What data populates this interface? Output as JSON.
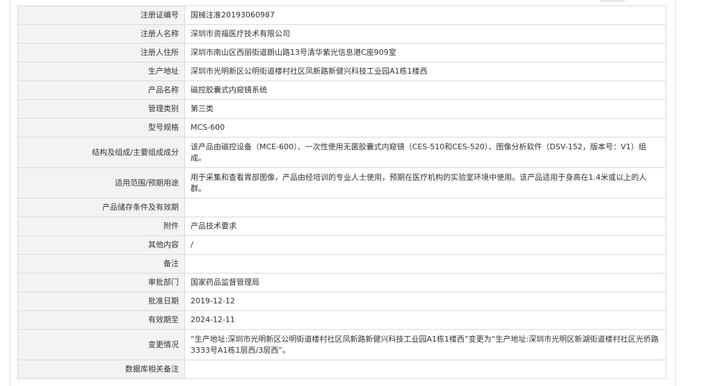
{
  "rows": [
    {
      "label": "注册证编号",
      "value": "国械注准20193060987"
    },
    {
      "label": "注册人名称",
      "value": "深圳市资福医疗技术有限公司"
    },
    {
      "label": "注册人住所",
      "value": "深圳市南山区西丽街道朗山路13号清华紫光信息港C座909室"
    },
    {
      "label": "生产地址",
      "value": "深圳市光明新区公明街道楼村社区凤新路新健兴科技工业园A1栋1楼西"
    },
    {
      "label": "产品名称",
      "value": "磁控胶囊式内窥镜系统"
    },
    {
      "label": "管理类别",
      "value": "第三类"
    },
    {
      "label": "型号规格",
      "value": "MCS-600"
    },
    {
      "label": "结构及组成/主要组成成分",
      "value": "该产品由磁控设备（MCE-600）、一次性使用无菌胶囊式内窥镜（CES-510和CES-520）、图像分析软件（DSV-152，版本号：V1）组成。"
    },
    {
      "label": "适用范围/预期用途",
      "value": "用于采集和查看胃部图像，产品由经培训的专业人士使用，预期在医疗机构的实验室环境中使用。该产品适用于身高在1.4米或以上的人群。"
    },
    {
      "label": "产品储存条件及有效期",
      "value": ""
    },
    {
      "label": "附件",
      "value": "产品技术要求"
    },
    {
      "label": "其他内容",
      "value": "/"
    },
    {
      "label": "备注",
      "value": ""
    },
    {
      "label": "审批部门",
      "value": "国家药品监督管理局"
    },
    {
      "label": "批准日期",
      "value": "2019-12-12"
    },
    {
      "label": "有效期至",
      "value": "2024-12-11"
    },
    {
      "label": "变更情况",
      "value": "“生产地址:深圳市光明新区公明街道楼村社区凤新路新健兴科技工业园A1栋1楼西”变更为“生产地址:深圳市光明区新湖街道楼村社区光侨路3333号A1栋1层西/3层西”。"
    },
    {
      "label": "数据库相关备注",
      "value": ""
    }
  ]
}
